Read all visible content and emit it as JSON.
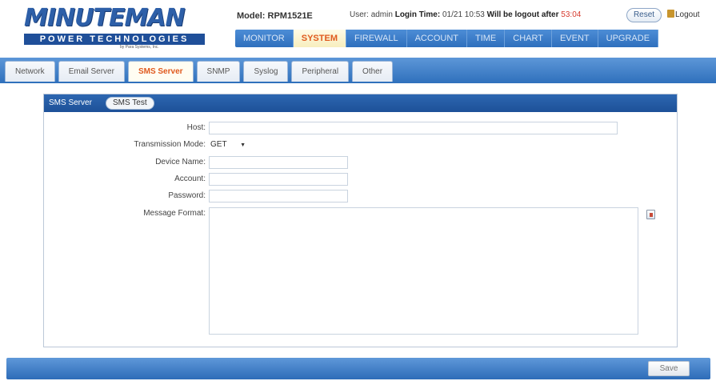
{
  "header": {
    "logo_main": "MINUTEMAN",
    "logo_sub": "POWER TECHNOLOGIES",
    "logo_tiny": "by Para Systems, Inc.",
    "model_label": "Model:",
    "model_value": "RPM1521E",
    "user_label": "User:",
    "user_value": "admin",
    "login_label": "Login Time:",
    "login_value": "01/21 10:53",
    "logout_after_label": "Will be logout after",
    "logout_after_value": "53:04",
    "reset_label": "Reset",
    "logout_label": "Logout"
  },
  "main_nav": [
    {
      "label": "MONITOR"
    },
    {
      "label": "SYSTEM"
    },
    {
      "label": "FIREWALL"
    },
    {
      "label": "ACCOUNT"
    },
    {
      "label": "TIME"
    },
    {
      "label": "CHART"
    },
    {
      "label": "EVENT"
    },
    {
      "label": "UPGRADE"
    }
  ],
  "main_nav_active": "SYSTEM",
  "sub_tabs": [
    {
      "label": "Network"
    },
    {
      "label": "Email Server"
    },
    {
      "label": "SMS Server"
    },
    {
      "label": "SNMP"
    },
    {
      "label": "Syslog"
    },
    {
      "label": "Peripheral"
    },
    {
      "label": "Other"
    }
  ],
  "sub_tab_active": "SMS Server",
  "panel": {
    "title": "SMS Server",
    "test_button": "SMS Test"
  },
  "form": {
    "host_label": "Host:",
    "host_value": "",
    "mode_label": "Transmission Mode:",
    "mode_value": "GET",
    "device_label": "Device Name:",
    "device_value": "",
    "account_label": "Account:",
    "account_value": "",
    "password_label": "Password:",
    "password_value": "",
    "message_label": "Message Format:",
    "message_value": ""
  },
  "footer": {
    "save_label": "Save"
  },
  "colors": {
    "accent_blue": "#2f70bc",
    "active_tab_text": "#e05a1f",
    "countdown_red": "#d63a2e"
  },
  "icons": {
    "mode_dropdown": "caret-down-icon",
    "message_help": "document-icon",
    "logout": "logout-icon"
  }
}
